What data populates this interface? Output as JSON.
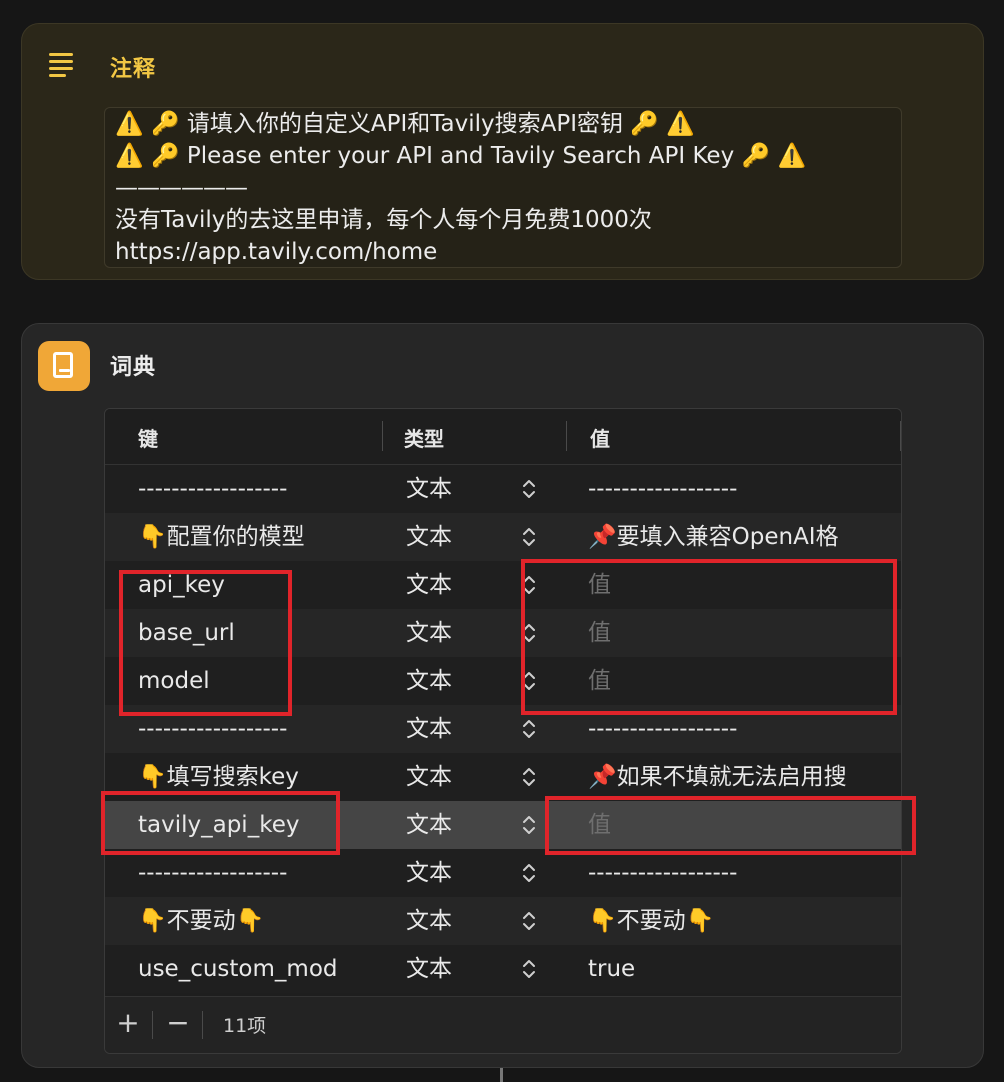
{
  "comment": {
    "title": "注释",
    "lines": [
      "⚠️ 🔑 请填入你的自定义API和Tavily搜索API密钥 🔑 ⚠️",
      "⚠️ 🔑 Please enter your API and Tavily Search API Key 🔑 ⚠️",
      "——————",
      "没有Tavily的去这里申请，每个人每个月免费1000次",
      "https://app.tavily.com/home"
    ]
  },
  "dictionary": {
    "title": "词典",
    "headers": {
      "key": "键",
      "type": "类型",
      "value": "值"
    },
    "rows": [
      {
        "key": "------------------",
        "type": "文本",
        "value": "------------------"
      },
      {
        "key": "👇配置你的模型",
        "type": "文本",
        "value": "📌要填入兼容OpenAI格"
      },
      {
        "key": "api_key",
        "type": "文本",
        "value": "值"
      },
      {
        "key": "base_url",
        "type": "文本",
        "value": "值"
      },
      {
        "key": "model",
        "type": "文本",
        "value": "值"
      },
      {
        "key": "------------------",
        "type": "文本",
        "value": "------------------"
      },
      {
        "key": "👇填写搜索key",
        "type": "文本",
        "value": "📌如果不填就无法启用搜"
      },
      {
        "key": "tavily_api_key",
        "type": "文本",
        "value": "值"
      },
      {
        "key": "------------------",
        "type": "文本",
        "value": "------------------"
      },
      {
        "key": "👇不要动👇",
        "type": "文本",
        "value": "👇不要动👇"
      },
      {
        "key": "use_custom_mod",
        "type": "文本",
        "value": "true"
      }
    ],
    "footer": {
      "add": "+",
      "remove": "−",
      "count": "11项"
    }
  },
  "colors": {
    "comment_accent": "#f2c744",
    "dict_icon": "#f0a737",
    "highlight": "#e0242a"
  }
}
